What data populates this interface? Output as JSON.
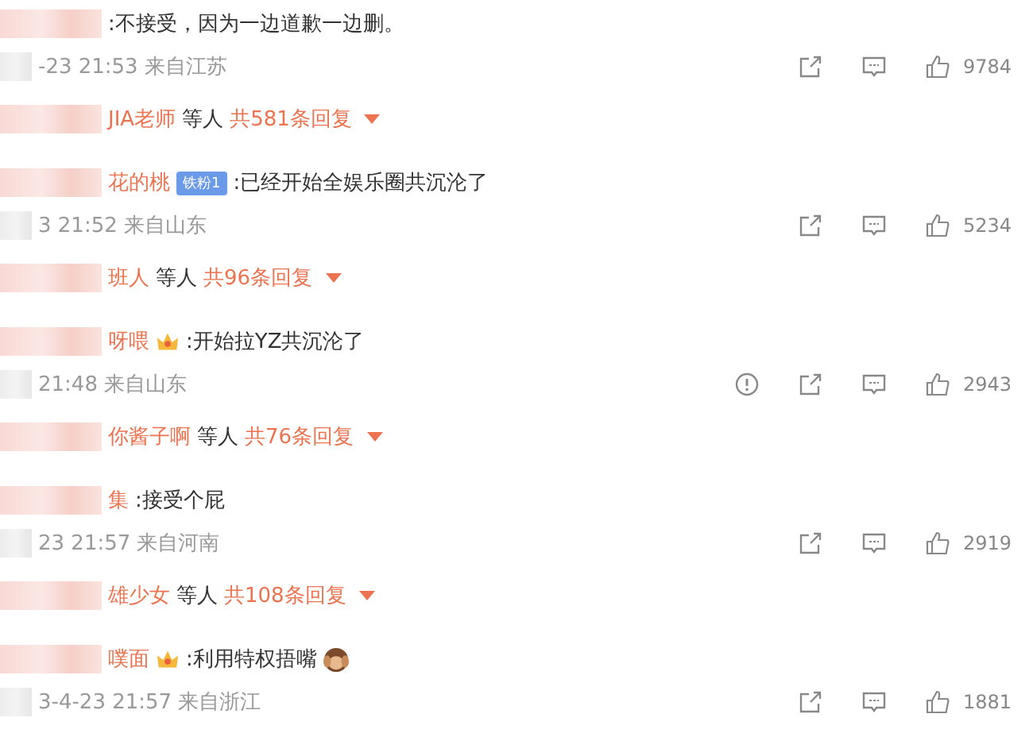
{
  "comments": [
    {
      "text": ":不接受，因为一边道歉一边删。",
      "emoji": false,
      "time": "-23 21:53",
      "location": "来自江苏",
      "report": false,
      "likes": "9784",
      "reply_name": "JIA老师",
      "reply_suffix": "等人",
      "reply_count": "共581条回复"
    },
    {
      "name": "花的桃",
      "badge": {
        "kind": "fan",
        "label": "铁粉1"
      },
      "text": ":已经开始全娱乐圈共沉沦了",
      "emoji": false,
      "time": "3 21:52",
      "location": "来自山东",
      "report": false,
      "likes": "5234",
      "reply_name": "班人",
      "reply_suffix": "等人",
      "reply_count": "共96条回复"
    },
    {
      "name": "呀喂",
      "badge": {
        "kind": "crown"
      },
      "text": ":开始拉YZ共沉沦了",
      "emoji": false,
      "time": "21:48",
      "location": "来自山东",
      "report": true,
      "likes": "2943",
      "reply_name": "你酱子啊",
      "reply_suffix": "等人",
      "reply_count": "共76条回复"
    },
    {
      "name": "集",
      "text": ":接受个屁",
      "emoji": false,
      "time": "23 21:57",
      "location": "来自河南",
      "report": false,
      "likes": "2919",
      "reply_name": "雄少女",
      "reply_suffix": "等人",
      "reply_count": "共108条回复"
    },
    {
      "name": "噗面",
      "badge": {
        "kind": "crown"
      },
      "text": ":利用特权捂嘴",
      "emoji": true,
      "time": "3-4-23 21:57",
      "location": "来自浙江",
      "report": false,
      "likes": "1881"
    }
  ]
}
